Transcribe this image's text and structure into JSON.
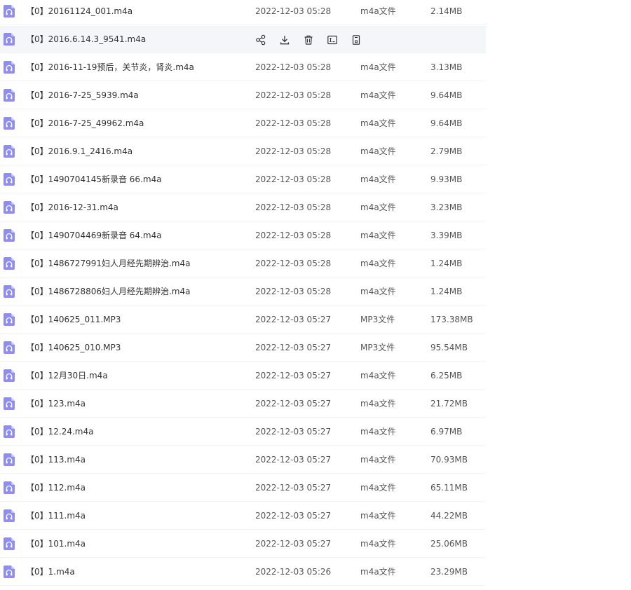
{
  "icons": {
    "file": "audio-file-icon",
    "actions": [
      "share-icon",
      "download-icon",
      "delete-icon",
      "rename-icon",
      "copy-icon"
    ]
  },
  "colors": {
    "file_icon": "#8f8ef0",
    "hover_row": "#f5f6fa",
    "action_icon": "#333333"
  },
  "files": [
    {
      "name": "【0】20161124_001.m4a",
      "date": "2022-12-03 05:28",
      "type": "m4a文件",
      "size": "2.14MB"
    },
    {
      "name": "【0】2016.6.14.3_9541.m4a",
      "date": "",
      "type": "",
      "size": "",
      "hovered": true
    },
    {
      "name": "【0】2016-11-19预后，关节炎，肾炎.m4a",
      "date": "2022-12-03 05:28",
      "type": "m4a文件",
      "size": "3.13MB"
    },
    {
      "name": "【0】2016-7-25_5939.m4a",
      "date": "2022-12-03 05:28",
      "type": "m4a文件",
      "size": "9.64MB"
    },
    {
      "name": "【0】2016-7-25_49962.m4a",
      "date": "2022-12-03 05:28",
      "type": "m4a文件",
      "size": "9.64MB"
    },
    {
      "name": "【0】2016.9.1_2416.m4a",
      "date": "2022-12-03 05:28",
      "type": "m4a文件",
      "size": "2.79MB"
    },
    {
      "name": "【0】1490704145新录音 66.m4a",
      "date": "2022-12-03 05:28",
      "type": "m4a文件",
      "size": "9.93MB"
    },
    {
      "name": "【0】2016-12-31.m4a",
      "date": "2022-12-03 05:28",
      "type": "m4a文件",
      "size": "3.23MB"
    },
    {
      "name": "【0】1490704469新录音 64.m4a",
      "date": "2022-12-03 05:28",
      "type": "m4a文件",
      "size": "3.39MB"
    },
    {
      "name": "【0】1486727991妇人月经先期辨治.m4a",
      "date": "2022-12-03 05:28",
      "type": "m4a文件",
      "size": "1.24MB"
    },
    {
      "name": "【0】1486728806妇人月经先期辨治.m4a",
      "date": "2022-12-03 05:28",
      "type": "m4a文件",
      "size": "1.24MB"
    },
    {
      "name": "【0】140625_011.MP3",
      "date": "2022-12-03 05:27",
      "type": "MP3文件",
      "size": "173.38MB"
    },
    {
      "name": "【0】140625_010.MP3",
      "date": "2022-12-03 05:27",
      "type": "MP3文件",
      "size": "95.54MB"
    },
    {
      "name": "【0】12月30日.m4a",
      "date": "2022-12-03 05:27",
      "type": "m4a文件",
      "size": "6.25MB"
    },
    {
      "name": "【0】123.m4a",
      "date": "2022-12-03 05:27",
      "type": "m4a文件",
      "size": "21.72MB"
    },
    {
      "name": "【0】12.24.m4a",
      "date": "2022-12-03 05:27",
      "type": "m4a文件",
      "size": "6.97MB"
    },
    {
      "name": "【0】113.m4a",
      "date": "2022-12-03 05:27",
      "type": "m4a文件",
      "size": "70.93MB"
    },
    {
      "name": "【0】112.m4a",
      "date": "2022-12-03 05:27",
      "type": "m4a文件",
      "size": "65.11MB"
    },
    {
      "name": "【0】111.m4a",
      "date": "2022-12-03 05:27",
      "type": "m4a文件",
      "size": "44.22MB"
    },
    {
      "name": "【0】101.m4a",
      "date": "2022-12-03 05:27",
      "type": "m4a文件",
      "size": "25.06MB"
    },
    {
      "name": "【0】1.m4a",
      "date": "2022-12-03 05:26",
      "type": "m4a文件",
      "size": "23.29MB"
    }
  ]
}
